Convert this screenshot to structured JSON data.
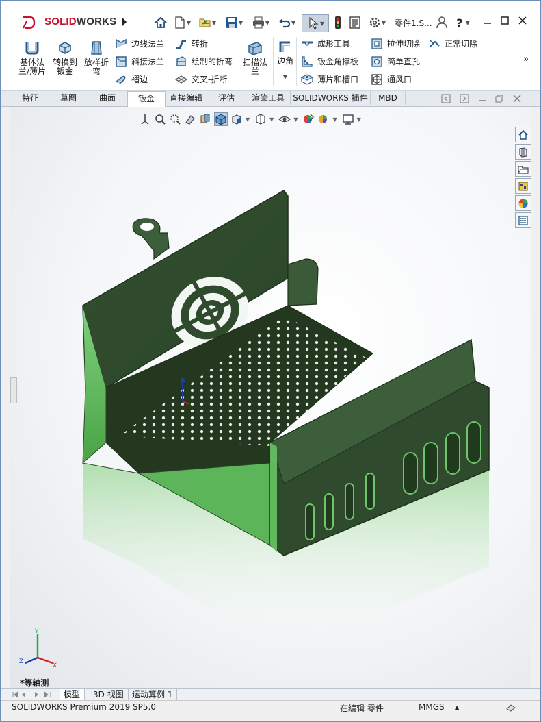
{
  "app": {
    "logo_text_prefix": "SOLID",
    "logo_text_suffix": "WORKS",
    "document_title": "零件1.S...",
    "brand_color": "#c8102e"
  },
  "quick_access": {
    "icons": [
      "home-icon",
      "new-document-icon",
      "open-icon",
      "save-icon",
      "print-icon",
      "undo-icon",
      "select-pointer-icon",
      "traffic-light-icon",
      "file-properties-icon",
      "options-gear-icon"
    ],
    "user_icon": "user-icon",
    "help_label": "?"
  },
  "ribbon": {
    "big_buttons": [
      {
        "label": "基体法兰/薄片",
        "icon": "base-flange-icon"
      },
      {
        "label": "转换到钣金",
        "icon": "convert-to-sheet-metal-icon"
      },
      {
        "label": "放样折弯",
        "icon": "lofted-bend-icon"
      },
      {
        "label": "扫描法兰",
        "icon": "swept-flange-icon"
      },
      {
        "label": "边角",
        "icon": "corners-icon"
      }
    ],
    "col1": [
      {
        "label": "边线法兰",
        "icon": "edge-flange-icon"
      },
      {
        "label": "斜接法兰",
        "icon": "miter-flange-icon"
      },
      {
        "label": "褶边",
        "icon": "hem-icon"
      }
    ],
    "col2": [
      {
        "label": "转折",
        "icon": "jog-icon"
      },
      {
        "label": "绘制的折弯",
        "icon": "sketched-bend-icon"
      },
      {
        "label": "交叉-折断",
        "icon": "cross-break-icon"
      }
    ],
    "col3": [
      {
        "label": "成形工具",
        "icon": "forming-tool-icon"
      },
      {
        "label": "钣金角撑板",
        "icon": "sheet-metal-gusset-icon"
      },
      {
        "label": "薄片和槽口",
        "icon": "tab-and-slot-icon"
      }
    ],
    "col4": [
      {
        "label": "拉伸切除",
        "icon": "extruded-cut-icon"
      },
      {
        "label": "简单直孔",
        "icon": "simple-hole-icon"
      },
      {
        "label": "通风口",
        "icon": "vent-icon"
      }
    ],
    "col5": [
      {
        "label": "正常切除",
        "icon": "normal-cut-icon"
      }
    ],
    "overflow_label": "»"
  },
  "command_tabs": [
    {
      "label": "特征",
      "active": false
    },
    {
      "label": "草图",
      "active": false
    },
    {
      "label": "曲面",
      "active": false
    },
    {
      "label": "钣金",
      "active": true
    },
    {
      "label": "直接编辑",
      "active": false
    },
    {
      "label": "评估",
      "active": false
    },
    {
      "label": "渲染工具",
      "active": false
    },
    {
      "label": "SOLIDWORKS 插件",
      "active": false
    },
    {
      "label": "MBD",
      "active": false
    }
  ],
  "heads_up_toolbar": [
    "zoom-to-fit-icon",
    "zoom-to-area-icon",
    "previous-view-icon",
    "section-view-icon",
    "dynamic-annotation-icon",
    "view-orientation-icon",
    "display-style-icon",
    "hide-show-items-icon",
    "edit-appearance-icon",
    "apply-scene-icon",
    "view-settings-icon"
  ],
  "task_pane": [
    "solidworks-resources-icon",
    "design-library-icon",
    "file-explorer-icon",
    "view-palette-icon",
    "appearances-icon",
    "custom-properties-icon"
  ],
  "viewport": {
    "view_name": "*等轴测",
    "triad_labels": {
      "x": "X",
      "y": "Y",
      "z": "Z"
    },
    "model_color": "#2f4a2e"
  },
  "bottom_tabs": [
    {
      "label": "模型",
      "active": true
    },
    {
      "label": "3D 视图",
      "active": false
    },
    {
      "label": "运动算例 1",
      "active": false
    }
  ],
  "status": {
    "product": "SOLIDWORKS Premium 2019 SP5.0",
    "mode": "在编辑 零件",
    "units": "MMGS",
    "units_arrow": "▲"
  }
}
